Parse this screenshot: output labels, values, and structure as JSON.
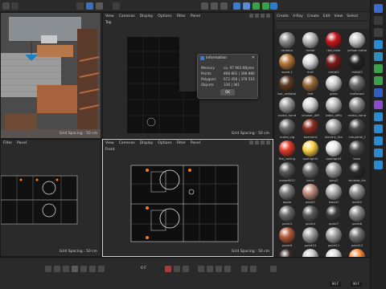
{
  "top_viewport": {
    "menu": [
      "View",
      "Cameras",
      "Display",
      "Options",
      "Filter",
      "Panel"
    ],
    "label": "Top",
    "grid": "Grid Spacing : 50 cm"
  },
  "left_viewport": {
    "menu": [
      "Filter",
      "Panel"
    ],
    "grid": "Grid Spacing : 50 cm"
  },
  "front_viewport": {
    "menu": [
      "View",
      "Cameras",
      "Display",
      "Options",
      "Filter",
      "Panel"
    ],
    "label": "Front",
    "grid": "Grid Spacing : 50 cm"
  },
  "side_viewport": {
    "menu": [
      "Panel"
    ],
    "grid": "Grid Spacing : 50 cm"
  },
  "persp_viewport": {
    "grid": "Grid Spacing : 50 cm"
  },
  "info_dialog": {
    "title": "Information",
    "rows": [
      {
        "label": "Memory",
        "value": "ca. 97 903 KBytes"
      },
      {
        "label": "Points",
        "value": "808 801 | 398 880"
      },
      {
        "label": "Polygons",
        "value": "672 456 | 378 510"
      },
      {
        "label": "Objects",
        "value": "336 | 361"
      }
    ],
    "ok_label": "OK"
  },
  "materials": {
    "menu": [
      "Create",
      "V-Ray",
      "Create",
      "Edit",
      "View",
      "Select"
    ],
    "items": [
      {
        "name": "radiator",
        "color": "#8a8a8a"
      },
      {
        "name": "metal",
        "color": "#b9b9b9"
      },
      {
        "name": "red_color",
        "color": "#c4161c"
      },
      {
        "name": "yellow metal",
        "color": "#c8c8c8"
      },
      {
        "name": "wood.1",
        "color": "#b8773a"
      },
      {
        "name": "fruit",
        "color": "#d9d9d9"
      },
      {
        "name": "metal2",
        "color": "#7b1a1a"
      },
      {
        "name": "metal3",
        "color": "#222222"
      },
      {
        "name": "bar_radiator",
        "color": "#5b3a22"
      },
      {
        "name": "leaf",
        "color": "#9a6a3a"
      },
      {
        "name": "glass",
        "color": "#cfcfcf"
      },
      {
        "name": "leafwood",
        "color": "#6d6d6d"
      },
      {
        "name": "metal_hand",
        "color": "#9a9a9a"
      },
      {
        "name": "shower_diff",
        "color": "#d5d5d5"
      },
      {
        "name": "table_diffu",
        "color": "#bcbcbc"
      },
      {
        "name": "metal_hand",
        "color": "#8c8c8c"
      },
      {
        "name": "metal_sig",
        "color": "#6a6a6a"
      },
      {
        "name": "bazment",
        "color": "#8a2e22"
      },
      {
        "name": "electric_fan",
        "color": "#a5a5a5"
      },
      {
        "name": "industrial_f",
        "color": "#4a4a4a"
      },
      {
        "name": "fire_ceiling",
        "color": "#e33a2a"
      },
      {
        "name": "spotlight2",
        "color": "#ffd34a"
      },
      {
        "name": "spotlight3",
        "color": "#e9e9e9"
      },
      {
        "name": "laser",
        "color": "#4a4a4a"
      },
      {
        "name": "anseeM12",
        "color": "#5a5a5a"
      },
      {
        "name": "brick",
        "color": "#6b6b6b"
      },
      {
        "name": "grey2",
        "color": "#9c9c9c"
      },
      {
        "name": "window_fra",
        "color": "#2a2a2a"
      },
      {
        "name": "apple",
        "color": "#7a7a7a"
      },
      {
        "name": "paint1",
        "color": "#c08a7a"
      },
      {
        "name": "wood1",
        "color": "#b0b0b0"
      },
      {
        "name": "paint2",
        "color": "#8f8f8f"
      },
      {
        "name": "paint3",
        "color": "#6a6a6a"
      },
      {
        "name": "paint4",
        "color": "#5a5a5a"
      },
      {
        "name": "paint7",
        "color": "#3c3c3c"
      },
      {
        "name": "paint8",
        "color": "#8a8a8a"
      },
      {
        "name": "paint9",
        "color": "#b55a3a"
      },
      {
        "name": "paint10",
        "color": "#9d9d9d"
      },
      {
        "name": "paint11",
        "color": "#a0a0a0"
      },
      {
        "name": "paint12",
        "color": "#727272"
      },
      {
        "name": "color_r1",
        "color": "#3a2a2a"
      },
      {
        "name": "paint13",
        "color": "#c9c9c9"
      },
      {
        "name": "paint14",
        "color": "#d8d8d8"
      },
      {
        "name": "paint15",
        "color": "#ff8c3a"
      }
    ],
    "selected_index": 40
  },
  "timeline": {
    "current_frame": "0 F",
    "start_frame": "90 F",
    "end_frame": "90 F"
  }
}
